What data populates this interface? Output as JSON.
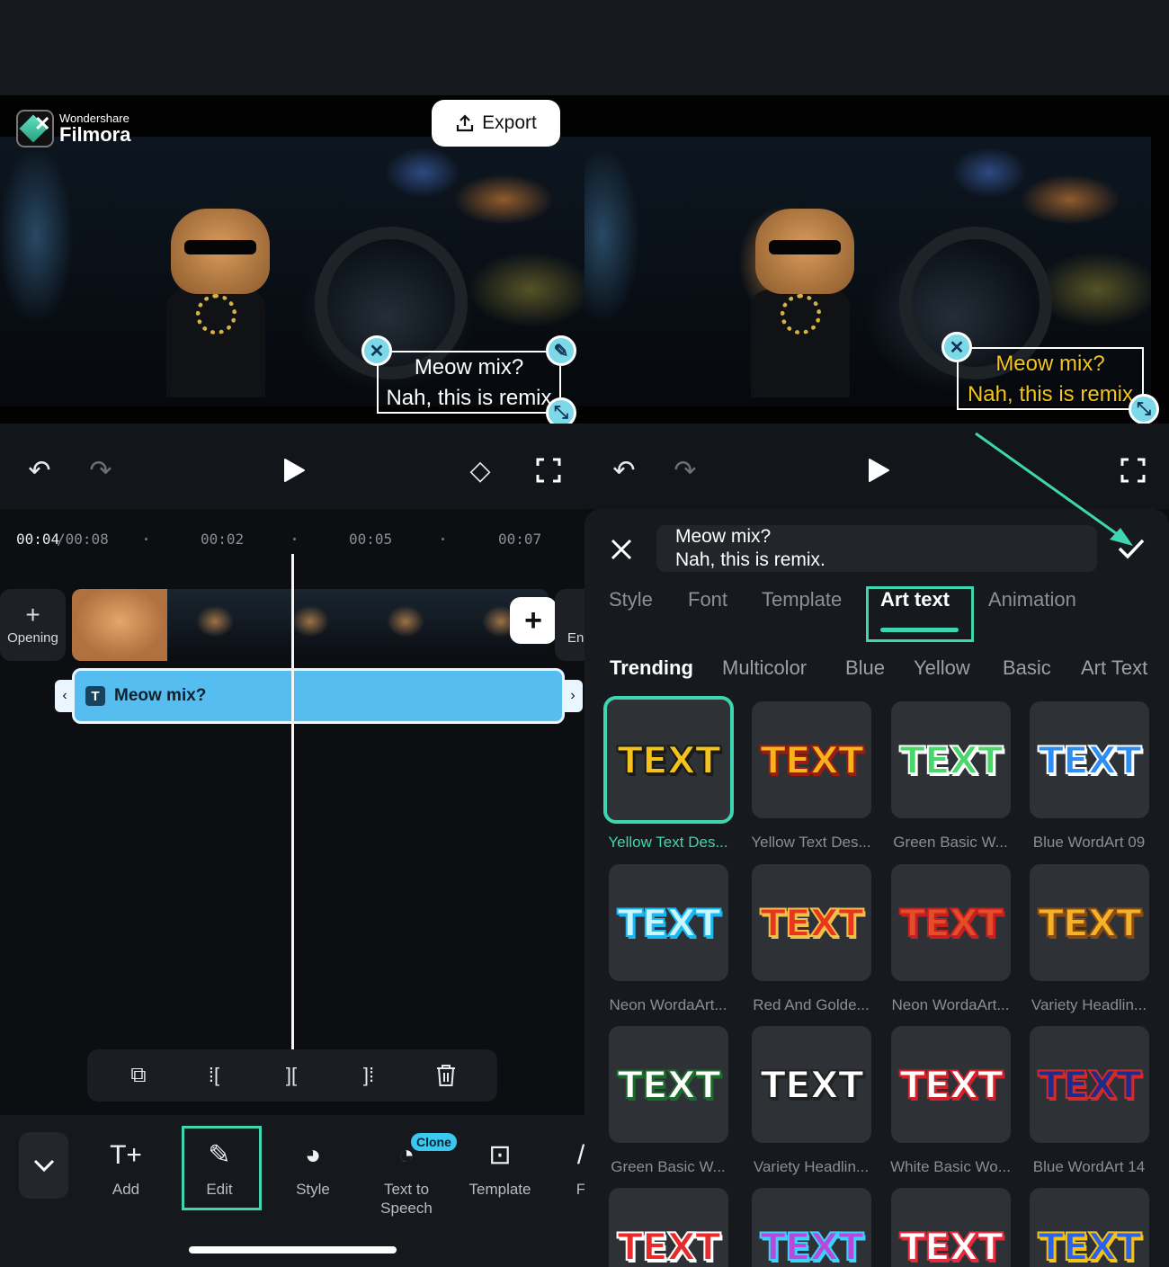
{
  "left": {
    "brand": {
      "small": "Wondershare",
      "big": "Filmora"
    },
    "export_label": "Export",
    "caption": {
      "line1": "Meow mix?",
      "line2": "Nah, this is remix"
    },
    "timecode": {
      "current": "00:04",
      "total": "/00:08"
    },
    "ruler": [
      "00:02",
      "00:05",
      "00:07"
    ],
    "opening_label": "Opening",
    "end_label": "En",
    "text_clip_label": "Meow mix?",
    "text_clip_icon": "T",
    "bottom_items": [
      {
        "icon": "add-text-icon",
        "label": "Add"
      },
      {
        "icon": "edit-pencil-icon",
        "label": "Edit"
      },
      {
        "icon": "palette-icon",
        "label": "Style"
      },
      {
        "icon": "speech-icon",
        "label": "Text to Speech",
        "badge": "Clone"
      },
      {
        "icon": "template-icon",
        "label": "Template"
      },
      {
        "icon": "font-icon",
        "label": "F"
      }
    ]
  },
  "right": {
    "caption": {
      "line1": "Meow mix?",
      "line2": "Nah, this is remix"
    },
    "input": {
      "line1": "Meow mix?",
      "line2": "Nah, this is remix."
    },
    "tabs": [
      "Style",
      "Font",
      "Template",
      "Art text",
      "Animation"
    ],
    "active_tab": "Art text",
    "categories": [
      "Trending",
      "Multicolor",
      "Blue",
      "Yellow",
      "Basic",
      "Art Text"
    ],
    "active_category": "Trending",
    "card_text": "TEXT",
    "presets": [
      {
        "label": "Yellow Text Des...",
        "fill": "#f4c21a",
        "stroke": "#1a1a1a",
        "selected": true
      },
      {
        "label": "Yellow Text Des...",
        "fill": "#f6b31c",
        "stroke": "#9b1d10"
      },
      {
        "label": "Green Basic W...",
        "fill": "#49d66b",
        "stroke": "#ffffff"
      },
      {
        "label": "Blue WordArt 09",
        "fill": "#2d8df2",
        "stroke": "#ffffff"
      },
      {
        "label": "Neon WordaArt...",
        "fill": "#c9f6ff",
        "stroke": "#19b8f0"
      },
      {
        "label": "Red And Golde...",
        "fill": "#e8361d",
        "stroke": "#f2c04a"
      },
      {
        "label": "Neon WordaArt...",
        "fill": "#e44d2a",
        "stroke": "#c61f1f"
      },
      {
        "label": "Variety Headlin...",
        "fill": "#f3b22a",
        "stroke": "#8a4b10"
      },
      {
        "label": "Green Basic W...",
        "fill": "#ffffff",
        "stroke": "#1c6b2a"
      },
      {
        "label": "Variety Headlin...",
        "fill": "#ffffff",
        "stroke": "#222222"
      },
      {
        "label": "White Basic Wo...",
        "fill": "#ffffff",
        "stroke": "#d0202a"
      },
      {
        "label": "Blue WordArt 14",
        "fill": "#1d2b8a",
        "stroke": "#d42a2a"
      },
      {
        "label": "",
        "fill": "#e82a2a",
        "stroke": "#ffffff"
      },
      {
        "label": "",
        "fill": "#b74bd9",
        "stroke": "#3fd0ff"
      },
      {
        "label": "",
        "fill": "#ffffff",
        "stroke": "#e42a3a"
      },
      {
        "label": "",
        "fill": "#2a62e8",
        "stroke": "#f6c21a"
      }
    ],
    "accent": "#3ed6b1"
  }
}
